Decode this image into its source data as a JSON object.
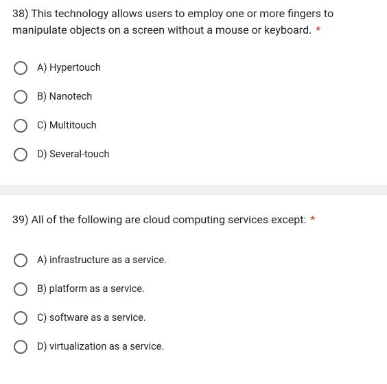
{
  "questions": [
    {
      "number": "38)",
      "text": "This technology allows users to employ one or more fingers to manipulate objects on a screen without a mouse or keyboard.",
      "required": "*",
      "options": [
        "A) Hypertouch",
        "B) Nanotech",
        "C) Multitouch",
        "D) Several-touch"
      ]
    },
    {
      "number": "39)",
      "text": "All of the following are cloud computing services except:",
      "required": "*",
      "options": [
        "A) infrastructure as a service.",
        "B) platform as a service.",
        "C) software as a service.",
        "D) virtualization as a service."
      ]
    }
  ]
}
